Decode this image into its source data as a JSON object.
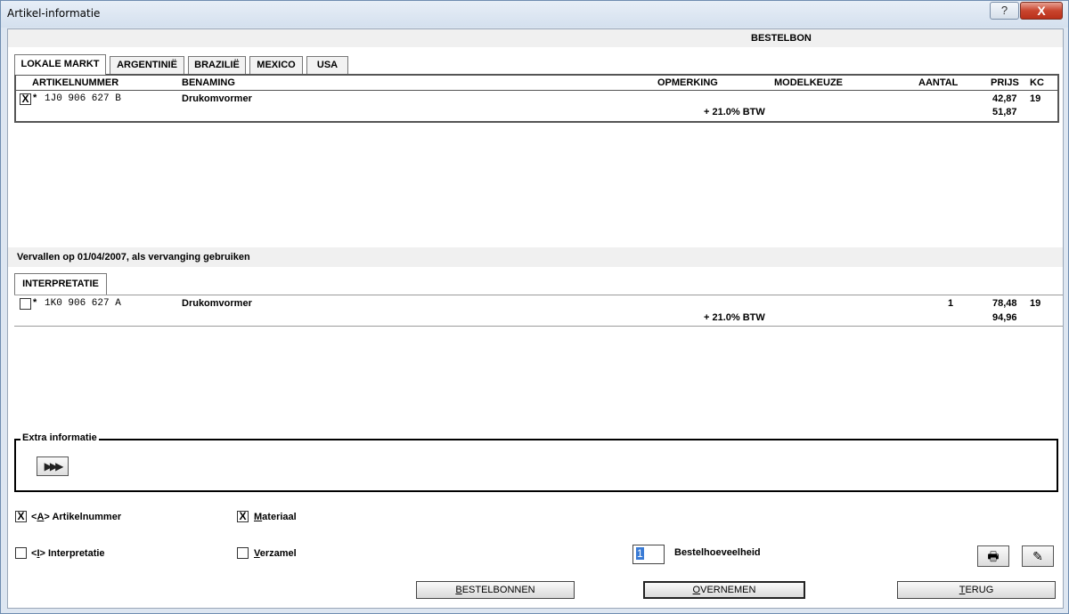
{
  "window": {
    "title": "Artikel-informatie",
    "help_label": "?",
    "close_label": "X"
  },
  "order": {
    "heading": "BESTELBON",
    "tabs": [
      "LOKALE MARKT",
      "ARGENTINIË",
      "BRAZILIË",
      "MEXICO",
      "USA"
    ],
    "columns": {
      "artikelnummer": "ARTIKELNUMMER",
      "benaming": "BENAMING",
      "opmerking": "OPMERKING",
      "modelkeuze": "MODELKEUZE",
      "aantal": "AANTAL",
      "prijs": "PRIJS",
      "kc": "KC"
    },
    "rows": [
      {
        "checked": true,
        "checkbox_glyph": "X",
        "star": "*",
        "part_number": "1J0 906 627 B",
        "name": "Drukomvormer",
        "quantity": "",
        "price": "42,87",
        "kc": "19",
        "vat_label": "+ 21.0% BTW",
        "price_incl": "51,87"
      }
    ]
  },
  "replacement": {
    "notice": "Vervallen op 01/04/2007, als vervanging gebruiken",
    "tab": "INTERPRETATIE",
    "rows": [
      {
        "checked": false,
        "checkbox_glyph": "",
        "star": "*",
        "part_number": "1K0 906 627 A",
        "name": "Drukomvormer",
        "quantity": "1",
        "price": "78,48",
        "kc": "19",
        "vat_label": "+ 21.0% BTW",
        "price_incl": "94,96"
      }
    ]
  },
  "extra": {
    "legend": "Extra informatie",
    "expand_glyph": "▶▶▶"
  },
  "options": {
    "artikelnummer": {
      "checked_glyph": "X",
      "prefix": "<",
      "key": "A",
      "suffix": "> Artikelnummer"
    },
    "materiaal": {
      "checked_glyph": "X",
      "key": "M",
      "rest": "ateriaal"
    },
    "interpretatie": {
      "checked_glyph": "",
      "prefix": "<",
      "key": "I",
      "suffix": "> Interpretatie"
    },
    "verzamel": {
      "checked_glyph": "",
      "key": "V",
      "rest": "erzamel"
    }
  },
  "quantity": {
    "value": "1",
    "label": "Bestelhoeveelheid"
  },
  "icons": {
    "print": "🖶",
    "edit": "✎"
  },
  "buttons": {
    "bestelbonnen": {
      "key": "B",
      "rest": "ESTELBONNEN"
    },
    "overnemen": {
      "key": "O",
      "rest": "VERNEMEN"
    },
    "terug": {
      "key": "T",
      "rest": "ERUG"
    }
  }
}
